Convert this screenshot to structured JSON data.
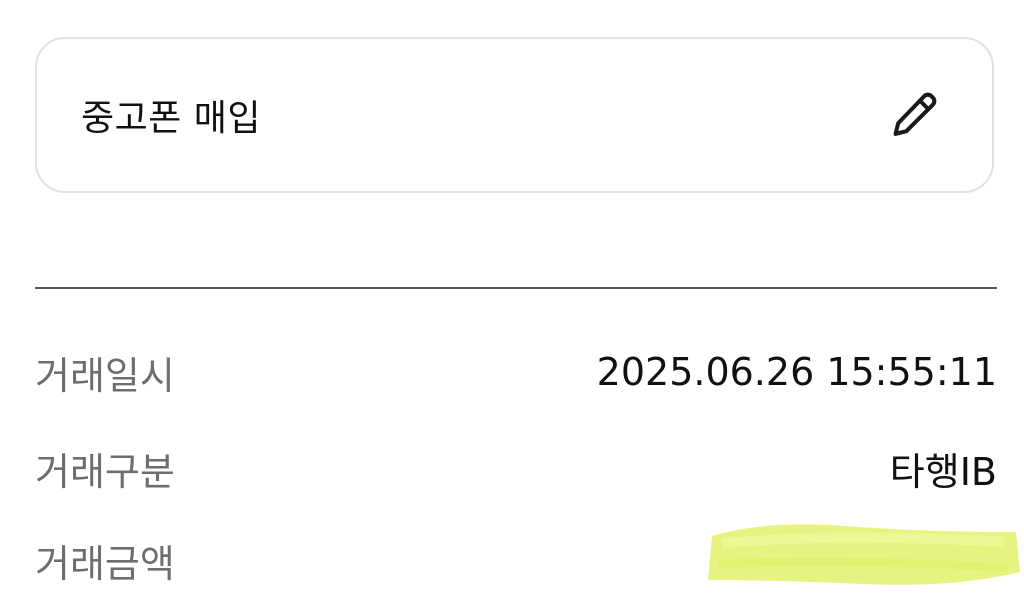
{
  "memo": {
    "text": "중고폰 매입",
    "edit_icon": "pencil-icon"
  },
  "details": {
    "rows": [
      {
        "label": "거래일시",
        "value": "2025.06.26 15:55:11"
      },
      {
        "label": "거래구분",
        "value": "타행IB"
      },
      {
        "label": "거래금액",
        "value": ""
      }
    ]
  },
  "colors": {
    "card_border": "#dfe1e6",
    "divider": "#55575c",
    "label_text": "#6e6e6e",
    "value_text": "#111111",
    "redaction_highlight": "#e6f27a"
  }
}
